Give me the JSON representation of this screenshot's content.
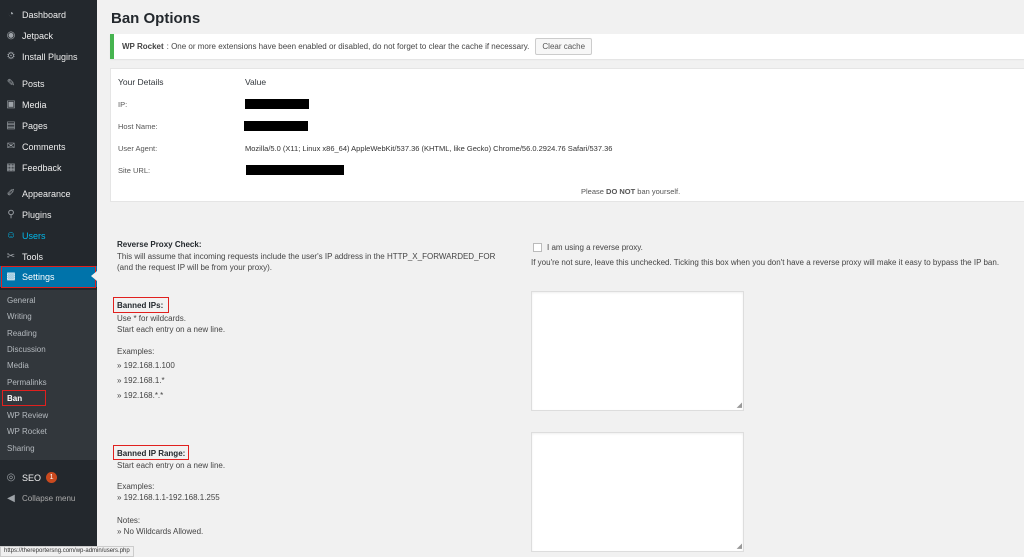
{
  "sidebar": {
    "items": [
      {
        "label": "Dashboard",
        "icon": "dashboard-icon",
        "glyph": "◔"
      },
      {
        "label": "Jetpack",
        "icon": "jetpack-icon",
        "glyph": "◉"
      },
      {
        "label": "Install Plugins",
        "icon": "install-plugins-icon",
        "glyph": "⚙"
      },
      {
        "label": "Posts",
        "icon": "pushpin-icon",
        "glyph": "✎"
      },
      {
        "label": "Media",
        "icon": "media-icon",
        "glyph": "▣"
      },
      {
        "label": "Pages",
        "icon": "pages-icon",
        "glyph": "▤"
      },
      {
        "label": "Comments",
        "icon": "comments-icon",
        "glyph": "✉"
      },
      {
        "label": "Feedback",
        "icon": "feedback-icon",
        "glyph": "▦"
      },
      {
        "label": "Appearance",
        "icon": "paintbrush-icon",
        "glyph": "✐"
      },
      {
        "label": "Plugins",
        "icon": "plugins-icon",
        "glyph": "⚲"
      },
      {
        "label": "Users",
        "icon": "users-icon",
        "glyph": "☺"
      },
      {
        "label": "Tools",
        "icon": "tools-icon",
        "glyph": "✂"
      },
      {
        "label": "Settings",
        "icon": "settings-icon",
        "glyph": "▩"
      }
    ],
    "submenu": [
      "General",
      "Writing",
      "Reading",
      "Discussion",
      "Media",
      "Permalinks",
      "Ban",
      "WP Review",
      "WP Rocket",
      "Sharing"
    ],
    "seo": {
      "label": "SEO",
      "badge": "1"
    },
    "collapse": "Collapse menu"
  },
  "page": {
    "title": "Ban Options"
  },
  "notice": {
    "brand": "WP Rocket",
    "text": ": One or more extensions have been enabled or disabled, do not forget to clear the cache if necessary.",
    "button": "Clear cache"
  },
  "details": {
    "col1": "Your Details",
    "col2": "Value",
    "ip_label": "IP:",
    "host_label": "Host Name:",
    "ua_label": "User Agent:",
    "ua_value": "Mozilla/5.0 (X11; Linux x86_64) AppleWebKit/537.36 (KHTML, like Gecko) Chrome/56.0.2924.76 Safari/537.36",
    "site_label": "Site URL:",
    "note_pre": "Please ",
    "note_strong": "DO NOT",
    "note_post": " ban yourself."
  },
  "proxy": {
    "title": "Reverse Proxy Check:",
    "desc1": "This will assume that incoming requests include the user's IP address in the HTTP_X_FORWARDED_FOR",
    "desc2": "(and the request IP will be from your proxy).",
    "checkbox_label": "I am using a reverse proxy.",
    "checkbox_desc": "If you're not sure, leave this unchecked. Ticking this box when you don't have a reverse proxy will make it easy to bypass the IP ban."
  },
  "banned_ips": {
    "title": "Banned IPs:",
    "desc1": "Use * for wildcards.",
    "desc2": "Start each entry on a new line.",
    "examples_label": "Examples:",
    "examples": [
      "» 192.168.1.100",
      "» 192.168.1.*",
      "» 192.168.*.*"
    ]
  },
  "banned_range": {
    "title": "Banned IP Range:",
    "desc1": "Start each entry on a new line.",
    "examples_label": "Examples:",
    "example1": "» 192.168.1.1-192.168.1.255",
    "notes_label": "Notes:",
    "note1": "» No Wildcards Allowed."
  },
  "status_url": "https://thereportersng.com/wp-admin/users.php",
  "colors": {
    "sidebar": "#23282d",
    "accent": "#0073aa",
    "highlight": "#e0201e",
    "notice": "#46b450"
  }
}
